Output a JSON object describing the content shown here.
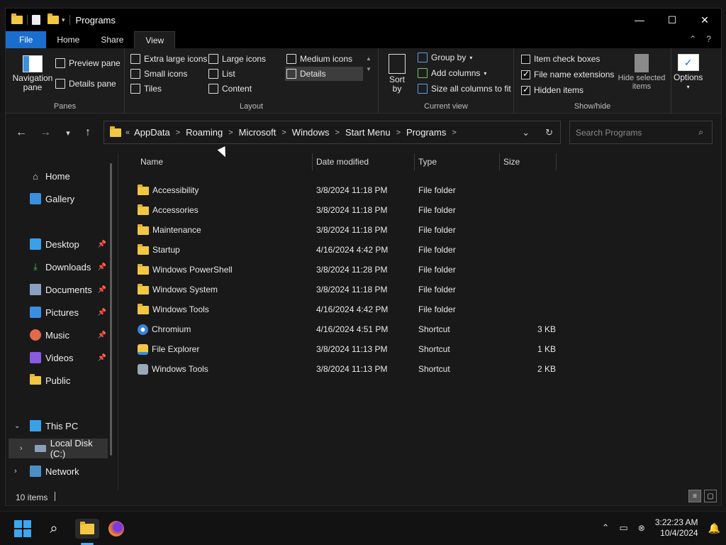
{
  "window": {
    "title": "Programs"
  },
  "tabs": [
    {
      "label": "File"
    },
    {
      "label": "Home"
    },
    {
      "label": "Share"
    },
    {
      "label": "View"
    }
  ],
  "ribbon": {
    "panes": {
      "label": "Panes",
      "navigation_pane": "Navigation pane",
      "preview_pane": "Preview pane",
      "details_pane": "Details pane"
    },
    "layout": {
      "label": "Layout",
      "extra_large_icons": "Extra large icons",
      "large_icons": "Large icons",
      "medium_icons": "Medium icons",
      "small_icons": "Small icons",
      "list": "List",
      "details": "Details",
      "tiles": "Tiles",
      "content": "Content"
    },
    "current_view": {
      "label": "Current view",
      "sort_by": "Sort by",
      "group_by": "Group by",
      "add_columns": "Add columns",
      "size_all_columns": "Size all columns to fit"
    },
    "show_hide": {
      "label": "Show/hide",
      "item_check_boxes": "Item check boxes",
      "file_name_extensions": "File name extensions",
      "hidden_items": "Hidden items",
      "hide_selected_items": "Hide selected items",
      "item_check_boxes_checked": false,
      "file_name_extensions_checked": true,
      "hidden_items_checked": true
    },
    "options": "Options"
  },
  "address": {
    "overflow": "«",
    "crumbs": [
      "AppData",
      "Roaming",
      "Microsoft",
      "Windows",
      "Start Menu",
      "Programs"
    ]
  },
  "search": {
    "placeholder": "Search Programs"
  },
  "sidebar": {
    "items": [
      {
        "label": "Home",
        "icon": "home-icon"
      },
      {
        "label": "Gallery",
        "icon": "gallery-icon"
      },
      {
        "label": "Desktop",
        "icon": "desktop-icon",
        "pinned": true
      },
      {
        "label": "Downloads",
        "icon": "downloads-icon",
        "pinned": true
      },
      {
        "label": "Documents",
        "icon": "documents-icon",
        "pinned": true
      },
      {
        "label": "Pictures",
        "icon": "pictures-icon",
        "pinned": true
      },
      {
        "label": "Music",
        "icon": "music-icon",
        "pinned": true
      },
      {
        "label": "Videos",
        "icon": "videos-icon",
        "pinned": true
      },
      {
        "label": "Public",
        "icon": "folder-icon"
      },
      {
        "label": "This PC",
        "icon": "computer-icon"
      },
      {
        "label": "Local Disk (C:)",
        "icon": "drive-icon"
      },
      {
        "label": "Network",
        "icon": "network-icon"
      }
    ]
  },
  "columns": [
    "Name",
    "Date modified",
    "Type",
    "Size"
  ],
  "files": [
    {
      "name": "Accessibility",
      "date": "3/8/2024 11:18 PM",
      "type": "File folder",
      "size": "",
      "kind": "folder"
    },
    {
      "name": "Accessories",
      "date": "3/8/2024 11:18 PM",
      "type": "File folder",
      "size": "",
      "kind": "folder"
    },
    {
      "name": "Maintenance",
      "date": "3/8/2024 11:18 PM",
      "type": "File folder",
      "size": "",
      "kind": "folder"
    },
    {
      "name": "Startup",
      "date": "4/16/2024 4:42 PM",
      "type": "File folder",
      "size": "",
      "kind": "folder"
    },
    {
      "name": "Windows PowerShell",
      "date": "3/8/2024 11:28 PM",
      "type": "File folder",
      "size": "",
      "kind": "folder"
    },
    {
      "name": "Windows System",
      "date": "3/8/2024 11:18 PM",
      "type": "File folder",
      "size": "",
      "kind": "folder"
    },
    {
      "name": "Windows Tools",
      "date": "4/16/2024 4:42 PM",
      "type": "File folder",
      "size": "",
      "kind": "folder"
    },
    {
      "name": "Chromium",
      "date": "4/16/2024 4:51 PM",
      "type": "Shortcut",
      "size": "3 KB",
      "kind": "chromium"
    },
    {
      "name": "File Explorer",
      "date": "3/8/2024 11:13 PM",
      "type": "Shortcut",
      "size": "1 KB",
      "kind": "explorer"
    },
    {
      "name": "Windows Tools",
      "date": "3/8/2024 11:13 PM",
      "type": "Shortcut",
      "size": "2 KB",
      "kind": "tools"
    }
  ],
  "status": {
    "item_count": "10 items"
  },
  "clock": {
    "time": "3:22:23 AM",
    "date": "10/4/2024"
  },
  "colors": {
    "accent": "#1a6ed0",
    "folder": "#f2c744"
  }
}
